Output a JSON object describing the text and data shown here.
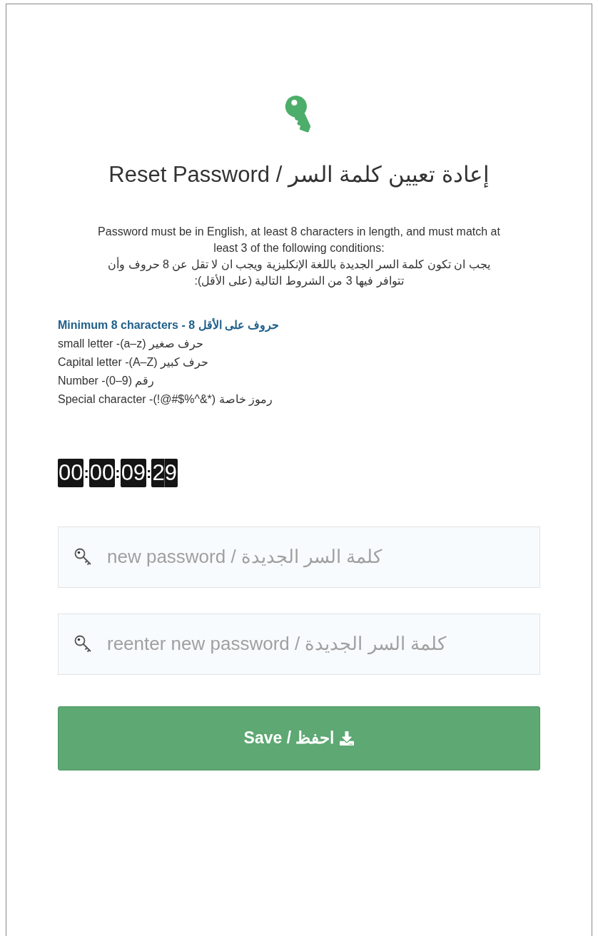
{
  "title": "إعادة تعيين كلمة السر / Reset Password",
  "instructions": [
    "Password must be in English, at least 8 characters in length, and must match at least 3 of the following conditions:",
    "يجب ان تكون كلمة السر الجديدة باللغة الإنكليزية ويجب ان لا تقل عن 8 حروف وأن تتوافر فيها 3 من الشروط التالية (على الأقل):"
  ],
  "conditions": [
    {
      "kind": "heading",
      "text": "Minimum 8 characters - 8 حروف على الأقل"
    },
    {
      "kind": "item",
      "text": "small letter -(a–z) حرف صغير"
    },
    {
      "kind": "item",
      "text": "Capital letter -(A–Z) حرف كبير"
    },
    {
      "kind": "item",
      "text": "Number -(0–9) رقم"
    },
    {
      "kind": "item",
      "text": "Special character -(!@#$%^&*) رموز خاصة"
    }
  ],
  "timer": "00:00:09:29",
  "fields": [
    {
      "placeholder": "new password / كلمة السر الجديدة"
    },
    {
      "placeholder": "reenter new password / كلمة السر الجديدة"
    }
  ],
  "save_button": "Save / احفظ"
}
